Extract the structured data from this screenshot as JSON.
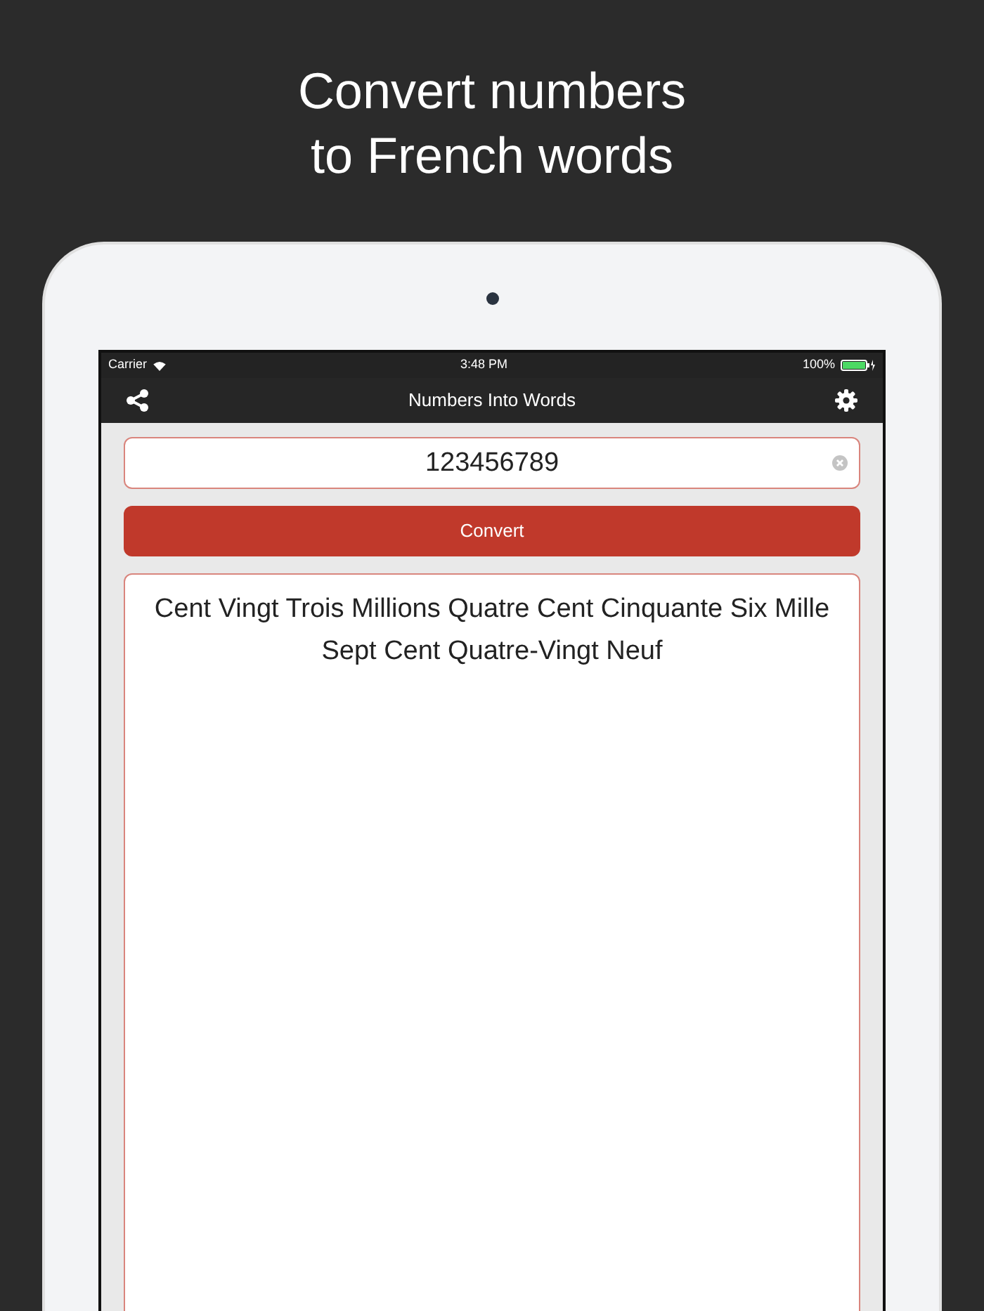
{
  "headline": {
    "lines": [
      "Convert numbers",
      "to French words"
    ]
  },
  "status_bar": {
    "carrier": "Carrier",
    "time": "3:48 PM",
    "battery": "100%"
  },
  "nav_bar": {
    "title": "Numbers Into Words"
  },
  "input": {
    "value": "123456789"
  },
  "convert_button": {
    "label": "Convert"
  },
  "output": {
    "text": "Cent Vingt Trois Millions Quatre Cent Cinquante Six Mille Sept Cent Quatre-Vingt Neuf"
  }
}
